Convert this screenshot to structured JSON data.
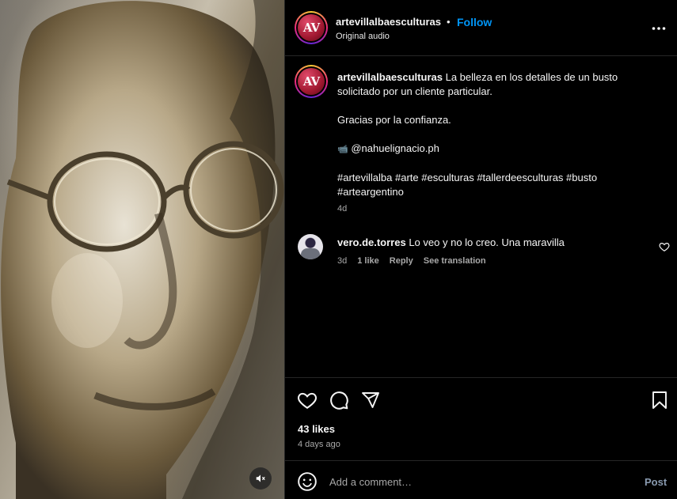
{
  "post": {
    "username": "artevillalbaesculturas",
    "follow_label": "Follow",
    "separator": "•",
    "audio_label": "Original audio",
    "avatar_text": "AV",
    "caption": {
      "username": "artevillalbaesculturas",
      "line1": "La belleza en los detalles de un busto solicitado por un cliente particular.",
      "line2": "Gracias por la confianza.",
      "credit_icon": "📹",
      "credit": "@nahuelignacio.ph",
      "hashtags": "#artevillalba #arte #esculturas #tallerdeesculturas #busto #arteargentino",
      "time": "4d"
    },
    "likes_label": "43 likes",
    "posted_ago": "4 days ago"
  },
  "comments": [
    {
      "username": "vero.de.torres",
      "text": "Lo veo y no lo creo. Una maravilla",
      "time": "3d",
      "likes": "1 like",
      "reply_label": "Reply",
      "translate_label": "See translation"
    }
  ],
  "composer": {
    "placeholder": "Add a comment…",
    "post_label": "Post"
  },
  "icons": {
    "more": "more-horizontal-icon",
    "like": "heart-icon",
    "comment": "comment-bubble-icon",
    "share": "paper-plane-icon",
    "save": "bookmark-icon",
    "emoji": "smiley-icon",
    "mute": "speaker-muted-icon"
  },
  "colors": {
    "background": "#000000",
    "accent": "#0095f6",
    "muted_text": "#a8a8a8",
    "divider": "#262626"
  }
}
